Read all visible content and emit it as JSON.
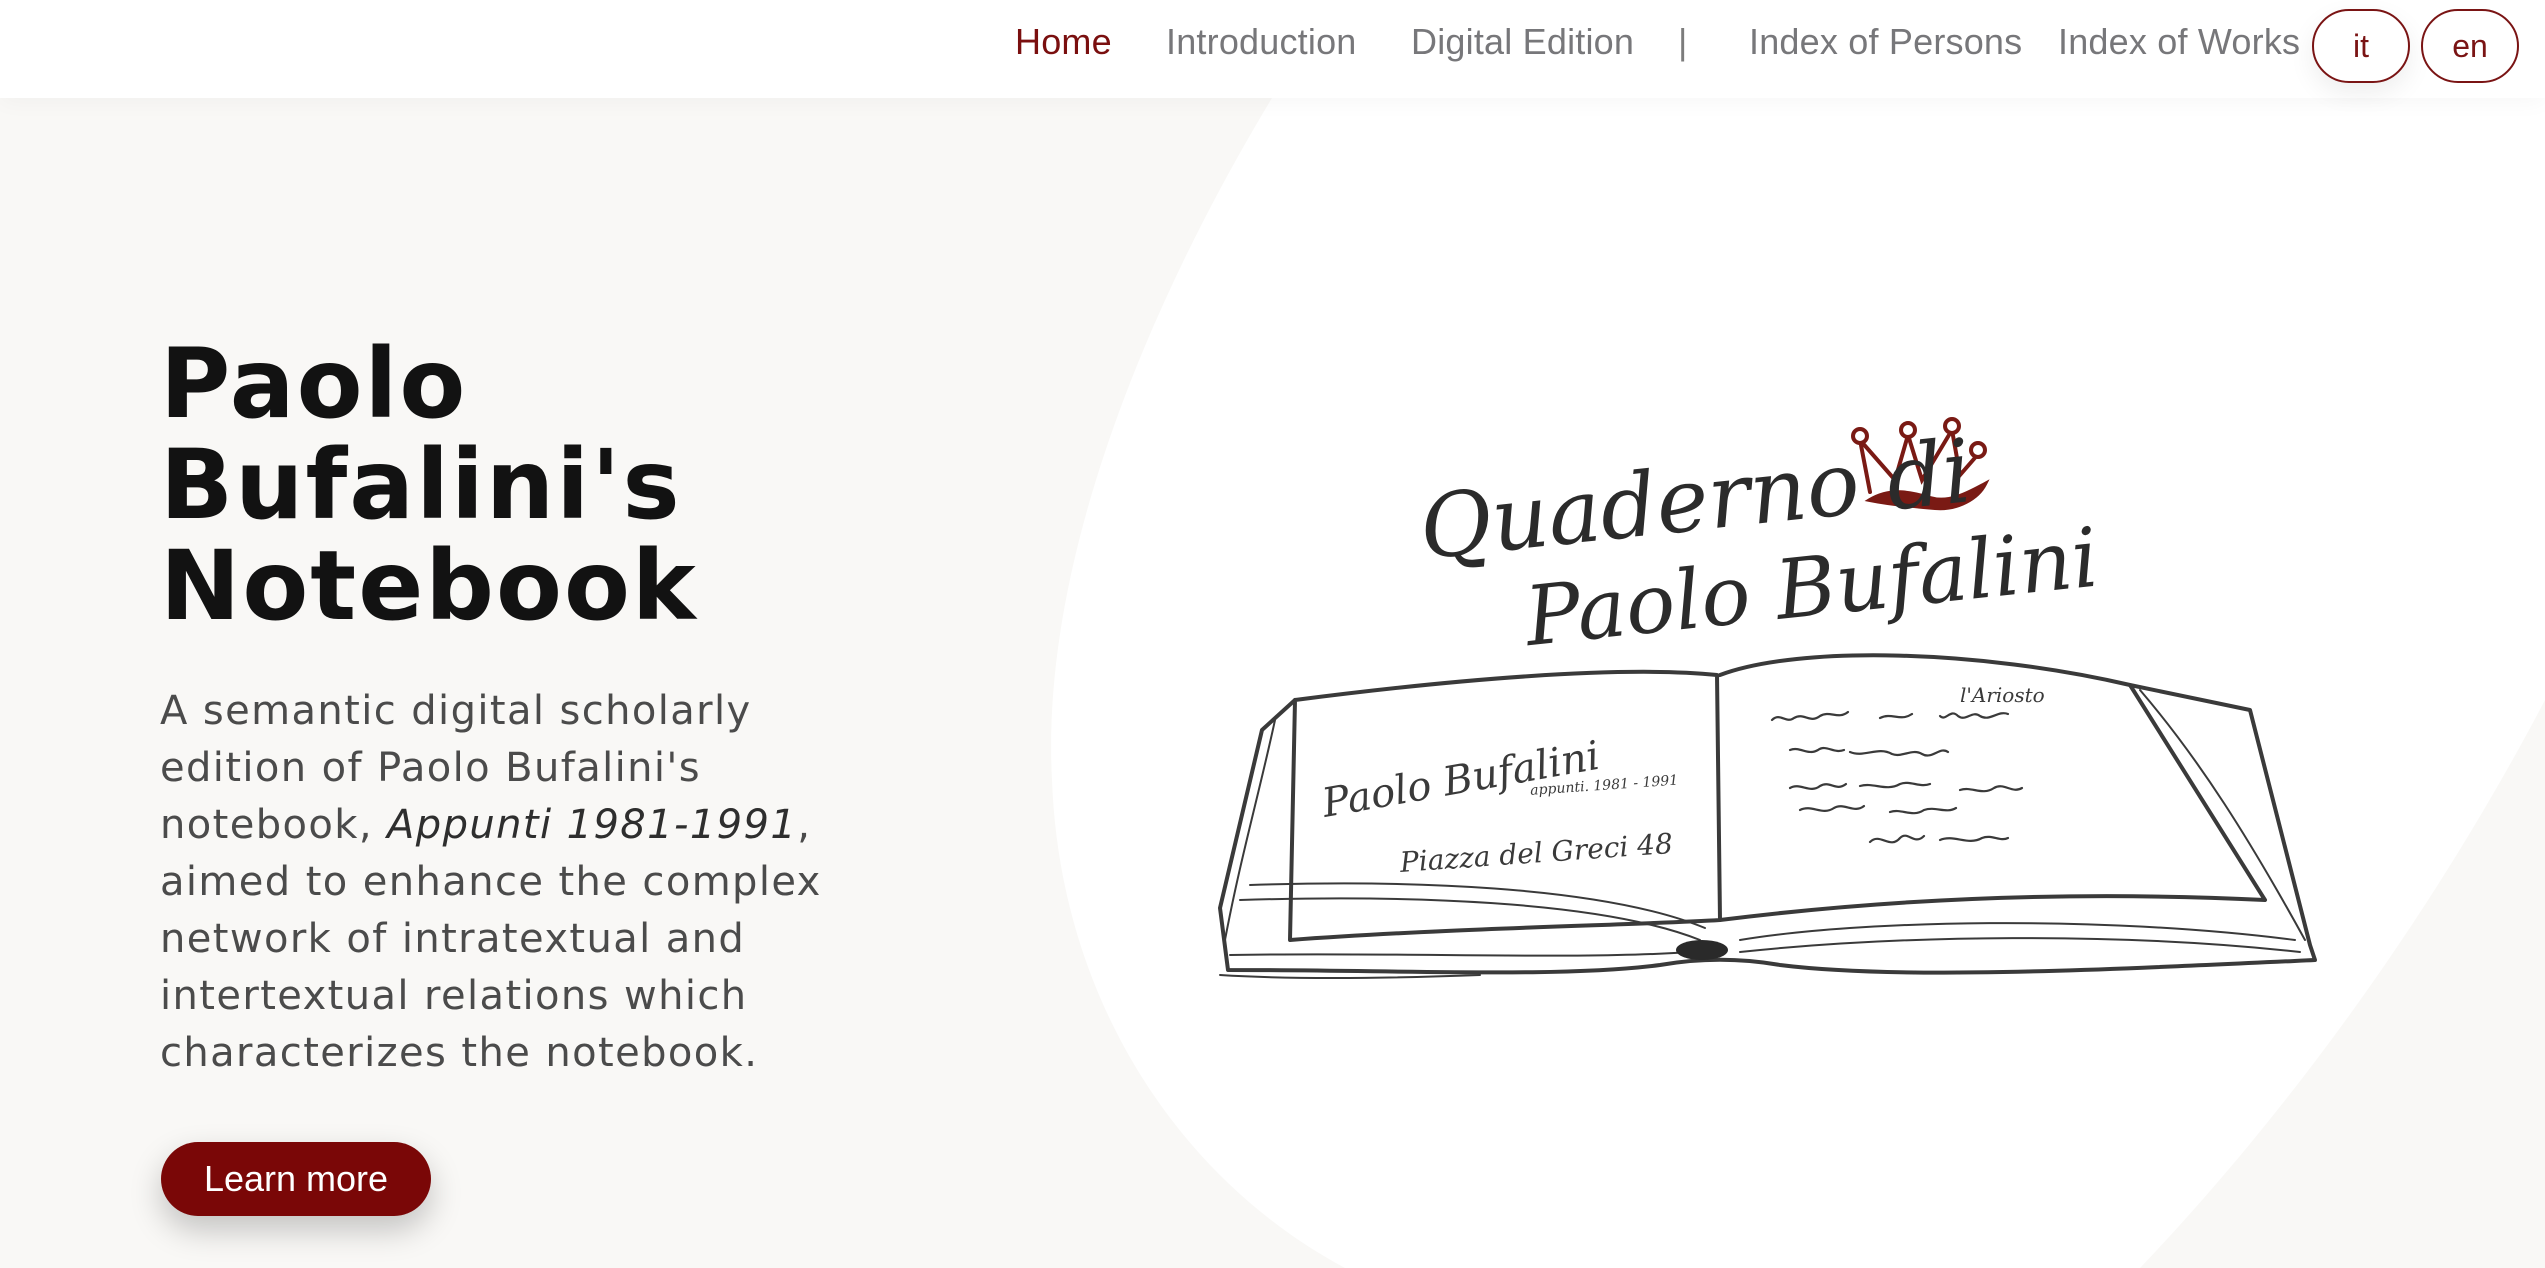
{
  "nav": {
    "items": [
      {
        "label": "Home",
        "active": true
      },
      {
        "label": "Introduction",
        "active": false
      },
      {
        "label": "Digital Edition",
        "active": false
      },
      {
        "label": "|",
        "active": false
      },
      {
        "label": "Index of Persons",
        "active": false
      },
      {
        "label": "Index of Works",
        "active": false
      }
    ],
    "languages": [
      "it",
      "en"
    ]
  },
  "hero": {
    "title_lines": [
      "Paolo",
      "Bufalini's",
      "Notebook"
    ],
    "description_before": "A semantic digital scholarly edition of Paolo Bufalini's notebook, ",
    "description_italic": "Appunti 1981-1991",
    "description_after": ", aimed to enhance the complex network of intratextual and intertextual relations which characterizes the notebook.",
    "button_label": "Learn more"
  },
  "illustration": {
    "logo_line1": "Quaderno di",
    "logo_line2": "Paolo Bufalini",
    "left_page_name": "Paolo Bufalini",
    "left_page_subtitle": "appunti. 1981 - 1991",
    "left_page_address": "Piazza del Greci 48",
    "right_page_heading": "l'Ariosto",
    "icon": "crown-icon"
  },
  "colors": {
    "accent": "#7a0707",
    "nav_active": "#7a0f0f",
    "nav_text": "#77777a",
    "title": "#121212",
    "background": "#f9f8f6",
    "panel": "#ffffff"
  }
}
